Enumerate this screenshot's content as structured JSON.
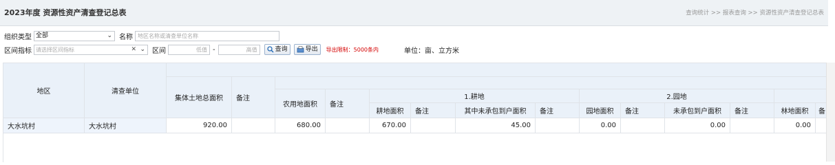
{
  "header": {
    "title": "2023年度 资源性资产清查登记总表",
    "breadcrumb": "查询统计 >> 报表查询 >> 资源性资产清查登记总表"
  },
  "filters": {
    "org_type_label": "组织类型",
    "org_type_value": "全部",
    "name_label": "名称",
    "name_placeholder": "地区名称或清查单位名称",
    "range_label": "区间指标",
    "range_placeholder": "请选择区间指标",
    "interval_label": "区间",
    "low_placeholder": "低值",
    "dash": "-",
    "high_placeholder": "高值",
    "search_button": "查询",
    "export_button": "导出",
    "export_limit": "导出限制：5000条内",
    "unit": "单位：亩、立方米"
  },
  "table": {
    "headers": {
      "region": "地区",
      "unit": "清查单位",
      "total_area": "集体土地总面积",
      "note": "备注",
      "farm_area": "农用地面积",
      "group_cultivated": "1.耕地",
      "group_garden": "2.园地",
      "cultivated_area": "耕地面积",
      "uncontracted_area": "其中未承包到户面积",
      "garden_area": "园地面积",
      "garden_uncontracted": "未承包到户面积",
      "forest_area": "林地面积",
      "partial_note": "备"
    },
    "rows": [
      {
        "region": "大水坑村",
        "unit": "大水坑村",
        "total_area": "920.00",
        "farm_area": "680.00",
        "cultivated_area": "670.00",
        "uncontracted_area": "45.00",
        "garden_area": "0.00",
        "garden_uncontracted": "0.00",
        "forest_area": "0.00"
      }
    ]
  },
  "colors": {
    "header_bg": "#eaf1f9",
    "export_limit": "#d40000",
    "button_border": "#9bb3cf"
  },
  "icons": [
    "search-icon",
    "export-icon",
    "clear-icon",
    "chevron-down-icon"
  ]
}
